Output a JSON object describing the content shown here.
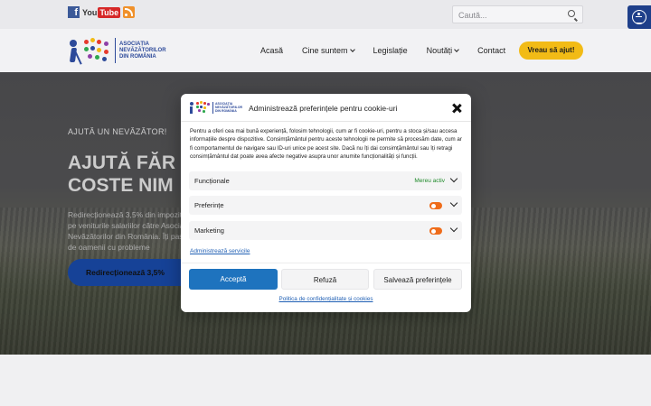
{
  "topbar": {
    "social": [
      {
        "name": "facebook-icon",
        "glyph": "f"
      },
      {
        "name": "youtube-icon",
        "you": "You",
        "tube": "Tube"
      },
      {
        "name": "rss-icon"
      }
    ],
    "search_placeholder": "Caută...",
    "accessibility_icon": "accessibility-icon"
  },
  "header": {
    "logo_text": [
      "ASOCIAȚIA",
      "NEVĂZĂTORILOR",
      "DIN ROMÂNIA"
    ],
    "nav": [
      {
        "label": "Acasă",
        "dropdown": false
      },
      {
        "label": "Cine suntem",
        "dropdown": true
      },
      {
        "label": "Legislație",
        "dropdown": false
      },
      {
        "label": "Noutăți",
        "dropdown": true
      },
      {
        "label": "Contact",
        "dropdown": false
      }
    ],
    "cta": "Vreau să ajut!"
  },
  "hero": {
    "kicker": "AJUTĂ UN NEVĂZĂTOR!",
    "title_line1": "AJUTĂ FĂR",
    "title_line2": "COSTE NIM",
    "text": "Redirecționează 3,5% din impozitul pe veniturile salariilor către Asociația Nevăzătorilor din România. Îți pasă de oamenii cu probleme",
    "button": "Redirecționează 3,5%"
  },
  "modal": {
    "title": "Administrează preferințele pentru cookie-uri",
    "logo_text": [
      "ASOCIAȚIA",
      "NEVĂZĂTORILOR",
      "DIN ROMÂNIA"
    ],
    "description": "Pentru a oferi cea mai bună experiență, folosim tehnologii, cum ar fi cookie-uri, pentru a stoca și/sau accesa informațiile despre dispozitive. Consimțământul pentru aceste tehnologii ne permite să procesăm date, cum ar fi comportamentul de navigare sau ID-uri unice pe acest site. Dacă nu îți dai consimțământul sau îți retragi consimțământul dat poate avea afecte negative asupra unor anumite funcționalități și funcții.",
    "categories": [
      {
        "label": "Funcționale",
        "status": "Mereu activ"
      },
      {
        "label": "Preferințe",
        "toggle": "off"
      },
      {
        "label": "Marketing",
        "toggle": "off"
      }
    ],
    "services_link": "Administrează servicile",
    "buttons": {
      "accept": "Acceptă",
      "deny": "Refuză",
      "save": "Salvează preferințele"
    },
    "policy_link": "Politica de confidențialitate și cookies"
  },
  "colors": {
    "primary": "#1e73be",
    "brand_blue": "#2d4a9a",
    "cta_yellow": "#f2bb16",
    "toggle_orange": "#ef6c1a",
    "active_green": "#1f8a2a"
  }
}
